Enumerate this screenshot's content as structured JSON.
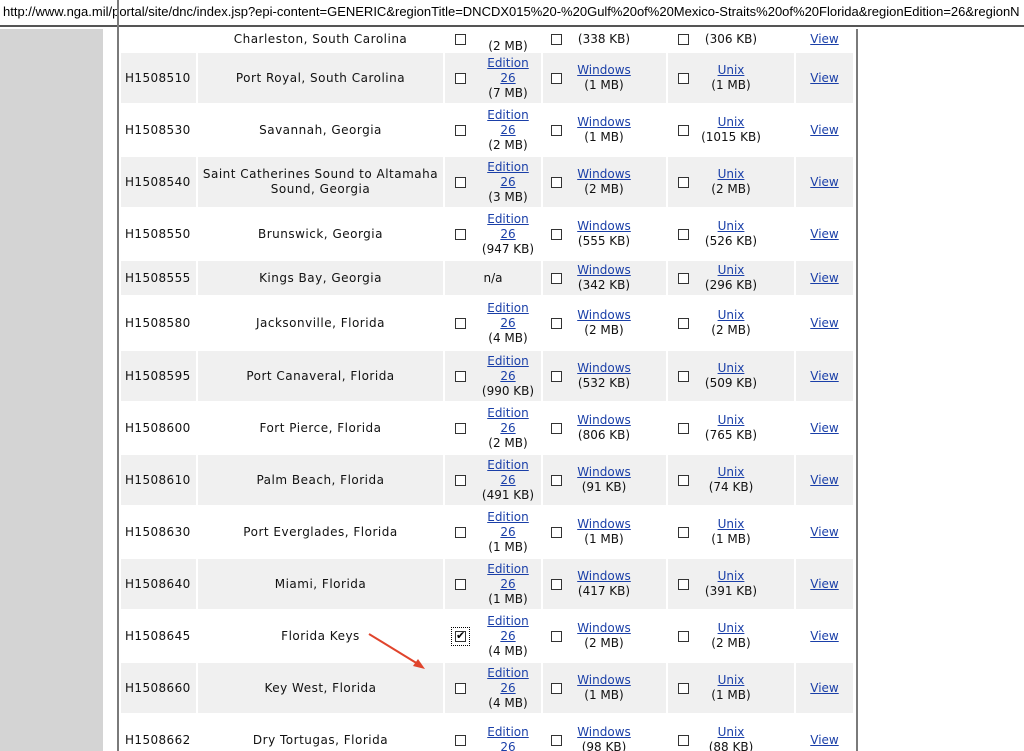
{
  "browser": {
    "url": "http://www.nga.mil/portal/site/dnc/index.jsp?epi-content=GENERIC&regionTitle=DNCDX015%20-%20Gulf%20of%20Mexico-Straits%20of%20Florida&regionEdition=26&regionN"
  },
  "rows": [
    {
      "id": "",
      "name": "Charleston, South Carolina",
      "edition_label": "",
      "edition_num": "",
      "edition_size": "(2 MB)",
      "win_label": "",
      "win_size": "(338 KB)",
      "unix_label": "",
      "unix_size": "(306 KB)",
      "view": "View"
    },
    {
      "id": "H1508510",
      "name": "Port Royal, South Carolina",
      "edition_label": "Edition",
      "edition_num": "26",
      "edition_size": "(7 MB)",
      "win_label": "Windows",
      "win_size": "(1 MB)",
      "unix_label": "Unix",
      "unix_size": "(1 MB)",
      "view": "View"
    },
    {
      "id": "H1508530",
      "name": "Savannah, Georgia",
      "edition_label": "Edition",
      "edition_num": "26",
      "edition_size": "(2 MB)",
      "win_label": "Windows",
      "win_size": "(1 MB)",
      "unix_label": "Unix",
      "unix_size": "(1015 KB)",
      "view": "View"
    },
    {
      "id": "H1508540",
      "name": "Saint Catherines Sound to Altamaha Sound, Georgia",
      "edition_label": "Edition",
      "edition_num": "26",
      "edition_size": "(3 MB)",
      "win_label": "Windows",
      "win_size": "(2 MB)",
      "unix_label": "Unix",
      "unix_size": "(2 MB)",
      "view": "View"
    },
    {
      "id": "H1508550",
      "name": "Brunswick, Georgia",
      "edition_label": "Edition",
      "edition_num": "26",
      "edition_size": "(947 KB)",
      "win_label": "Windows",
      "win_size": "(555 KB)",
      "unix_label": "Unix",
      "unix_size": "(526 KB)",
      "view": "View"
    },
    {
      "id": "H1508555",
      "name": "Kings Bay, Georgia",
      "edition_na": "n/a",
      "win_label": "Windows",
      "win_size": "(342 KB)",
      "unix_label": "Unix",
      "unix_size": "(296 KB)",
      "view": "View"
    },
    {
      "id": "H1508580",
      "name": "Jacksonville, Florida",
      "edition_label": "Edition",
      "edition_num": "26",
      "edition_size": "(4 MB)",
      "win_label": "Windows",
      "win_size": "(2 MB)",
      "unix_label": "Unix",
      "unix_size": "(2 MB)",
      "view": "View"
    },
    {
      "id": "H1508595",
      "name": "Port Canaveral, Florida",
      "edition_label": "Edition",
      "edition_num": "26",
      "edition_size": "(990 KB)",
      "win_label": "Windows",
      "win_size": "(532 KB)",
      "unix_label": "Unix",
      "unix_size": "(509 KB)",
      "view": "View"
    },
    {
      "id": "H1508600",
      "name": "Fort Pierce, Florida",
      "edition_label": "Edition",
      "edition_num": "26",
      "edition_size": "(2 MB)",
      "win_label": "Windows",
      "win_size": "(806 KB)",
      "unix_label": "Unix",
      "unix_size": "(765 KB)",
      "view": "View"
    },
    {
      "id": "H1508610",
      "name": "Palm Beach, Florida",
      "edition_label": "Edition",
      "edition_num": "26",
      "edition_size": "(491 KB)",
      "win_label": "Windows",
      "win_size": "(91 KB)",
      "unix_label": "Unix",
      "unix_size": "(74 KB)",
      "view": "View"
    },
    {
      "id": "H1508630",
      "name": "Port Everglades, Florida",
      "edition_label": "Edition",
      "edition_num": "26",
      "edition_size": "(1 MB)",
      "win_label": "Windows",
      "win_size": "(1 MB)",
      "unix_label": "Unix",
      "unix_size": "(1 MB)",
      "view": "View"
    },
    {
      "id": "H1508640",
      "name": "Miami, Florida",
      "edition_label": "Edition",
      "edition_num": "26",
      "edition_size": "(1 MB)",
      "win_label": "Windows",
      "win_size": "(417 KB)",
      "unix_label": "Unix",
      "unix_size": "(391 KB)",
      "view": "View"
    },
    {
      "id": "H1508645",
      "name": "Florida Keys",
      "edition_label": "Edition",
      "edition_num": "26",
      "edition_size": "(4 MB)",
      "win_label": "Windows",
      "win_size": "(2 MB)",
      "unix_label": "Unix",
      "unix_size": "(2 MB)",
      "view": "View",
      "edition_checked": true
    },
    {
      "id": "H1508660",
      "name": "Key West, Florida",
      "edition_label": "Edition",
      "edition_num": "26",
      "edition_size": "(4 MB)",
      "win_label": "Windows",
      "win_size": "(1 MB)",
      "unix_label": "Unix",
      "unix_size": "(1 MB)",
      "view": "View"
    },
    {
      "id": "H1508662",
      "name": "Dry Tortugas, Florida",
      "edition_label": "Edition",
      "edition_num": "26",
      "edition_size": "",
      "win_label": "Windows",
      "win_size": "(98 KB)",
      "unix_label": "Unix",
      "unix_size": "(88 KB)",
      "view": "View"
    }
  ],
  "colors": {
    "link": "#1a3fa8",
    "row_shade": "#f0f0f0",
    "annotation_arrow": "#e0442c"
  }
}
